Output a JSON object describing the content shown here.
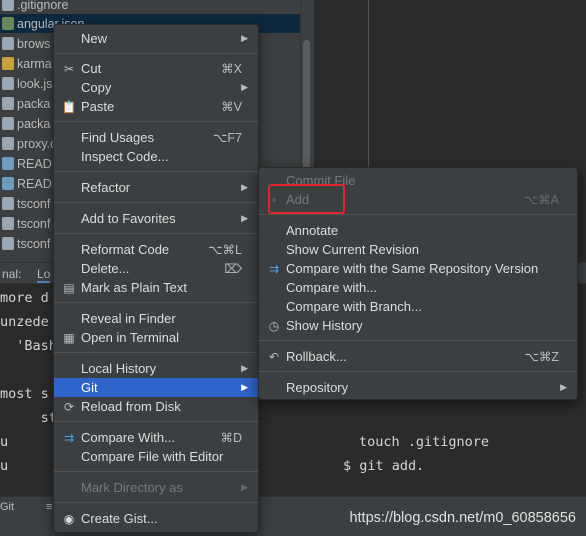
{
  "project_tree": {
    "items": [
      {
        "label": ".gitignore",
        "icon": "file-icon",
        "selected": false
      },
      {
        "label": "angular.json",
        "icon": "json-file-icon",
        "selected": true
      },
      {
        "label": "brows",
        "icon": "file-icon",
        "selected": false
      },
      {
        "label": "karma",
        "icon": "js-file-icon",
        "selected": false
      },
      {
        "label": "look.js",
        "icon": "file-icon",
        "selected": false
      },
      {
        "label": "packa",
        "icon": "file-icon",
        "selected": false
      },
      {
        "label": "packa",
        "icon": "file-icon",
        "selected": false
      },
      {
        "label": "proxy.c",
        "icon": "file-icon",
        "selected": false
      },
      {
        "label": "READI",
        "icon": "md-file-icon",
        "selected": false
      },
      {
        "label": "READI",
        "icon": "md-file-icon",
        "selected": false
      },
      {
        "label": "tsconf",
        "icon": "file-icon",
        "selected": false
      },
      {
        "label": "tsconf",
        "icon": "file-icon",
        "selected": false
      },
      {
        "label": "tsconf",
        "icon": "file-icon",
        "selected": false
      }
    ]
  },
  "terminal_tabs": {
    "label": "nal:",
    "tab1": "Lo"
  },
  "terminal": {
    "lines": [
      "more d",
      "unzede",
      "  'Bash",
      "",
      "most s",
      "     st",
      "u      ",
      "u      "
    ],
    "cmd1": "touch .gitignore",
    "cmd2": "$ git add."
  },
  "status_bar": {
    "item1": "Git",
    "item2": "≡"
  },
  "watermark": "https://blog.csdn.net/m0_60858656",
  "context_menu": {
    "new": {
      "label": "New"
    },
    "cut": {
      "label": "Cut",
      "shortcut": "⌘X"
    },
    "copy": {
      "label": "Copy"
    },
    "paste": {
      "label": "Paste",
      "shortcut": "⌘V"
    },
    "find_usages": {
      "label": "Find Usages",
      "shortcut": "⌥F7"
    },
    "inspect_code": {
      "label": "Inspect Code..."
    },
    "refactor": {
      "label": "Refactor"
    },
    "add_to_favorites": {
      "label": "Add to Favorites"
    },
    "reformat_code": {
      "label": "Reformat Code",
      "shortcut": "⌥⌘L"
    },
    "delete": {
      "label": "Delete..."
    },
    "mark_plain_text": {
      "label": "Mark as Plain Text"
    },
    "reveal_finder": {
      "label": "Reveal in Finder"
    },
    "open_terminal": {
      "label": "Open in Terminal"
    },
    "local_history": {
      "label": "Local History"
    },
    "git": {
      "label": "Git"
    },
    "reload_disk": {
      "label": "Reload from Disk"
    },
    "compare_with": {
      "label": "Compare With...",
      "shortcut": "⌘D"
    },
    "compare_file_editor": {
      "label": "Compare File with Editor"
    },
    "mark_directory": {
      "label": "Mark Directory as"
    },
    "create_gist": {
      "label": "Create Gist..."
    }
  },
  "git_submenu": {
    "commit_file": {
      "label": "Commit File"
    },
    "add": {
      "label": "Add",
      "shortcut": "⌥⌘A"
    },
    "annotate": {
      "label": "Annotate"
    },
    "show_current_revision": {
      "label": "Show Current Revision"
    },
    "compare_same_repo": {
      "label": "Compare with the Same Repository Version"
    },
    "compare_with": {
      "label": "Compare with..."
    },
    "compare_branch": {
      "label": "Compare with Branch..."
    },
    "show_history": {
      "label": "Show History"
    },
    "rollback": {
      "label": "Rollback...",
      "shortcut": "⌥⌘Z"
    },
    "repository": {
      "label": "Repository"
    }
  },
  "colors": {
    "menu_bg": "#3c3f41",
    "highlight": "#2f65ca",
    "annotation_red": "#e0262a"
  }
}
